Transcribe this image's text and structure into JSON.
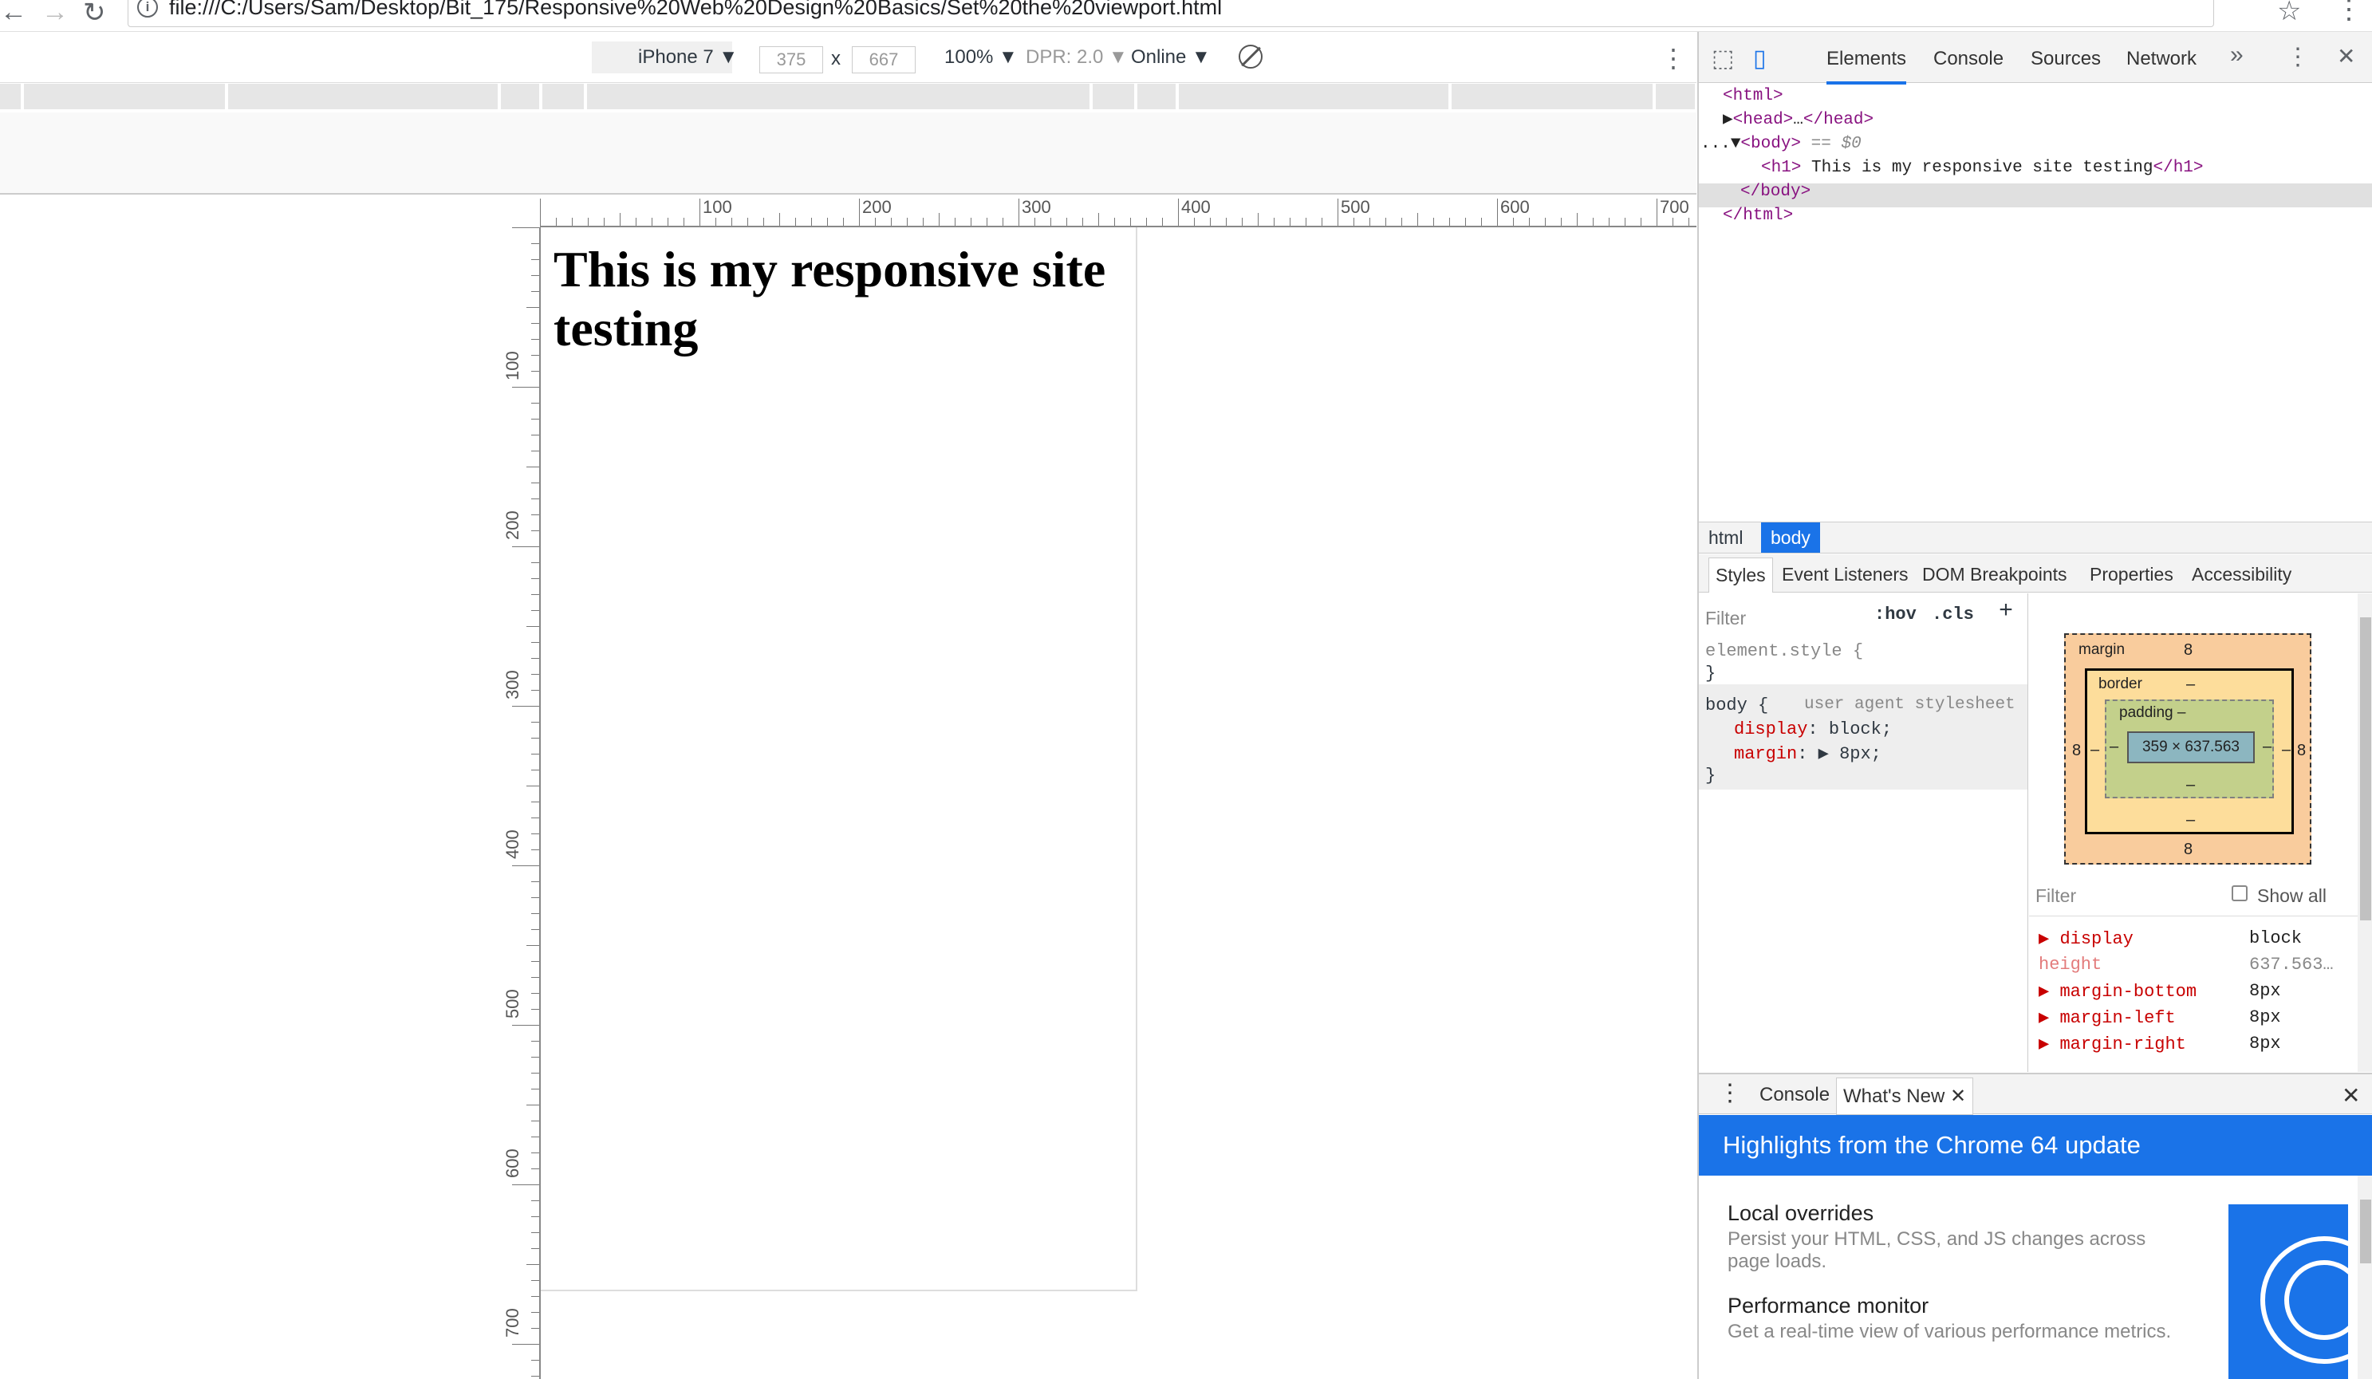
{
  "browser": {
    "back_icon": "arrow-left-icon",
    "forward_icon": "arrow-right-icon",
    "reload_icon": "reload-icon",
    "info_icon": "i",
    "url": "file:///C:/Users/Sam/Desktop/Bit_175/Responsive%20Web%20Design%20Basics/Set%20the%20viewport.html",
    "star": "☆",
    "menu": "⋮"
  },
  "device_toolbar": {
    "device": "iPhone 7",
    "width": "375",
    "times": "x",
    "height": "667",
    "zoom": "100%",
    "dpr": "DPR: 2.0",
    "network": "Online",
    "menu": "⋮"
  },
  "rulers": {
    "horizontal": [
      "100",
      "200",
      "300",
      "400",
      "500",
      "600",
      "700"
    ],
    "vertical": [
      "100",
      "200",
      "300",
      "400",
      "500",
      "600",
      "700"
    ]
  },
  "page": {
    "heading": "This is my responsive site testing"
  },
  "devtools": {
    "tabs": [
      "Elements",
      "Console",
      "Sources",
      "Network"
    ],
    "more": "»",
    "menu": "⋮",
    "close": "✕",
    "dom": {
      "html_open": "<html>",
      "head_open": "<head>",
      "head_ellipsis": "…",
      "head_close": "</head>",
      "dots": "...",
      "body_open": "<body>",
      "body_eq": "== $0",
      "h1_open": "<h1>",
      "h1_text": " This is my responsive site testing",
      "h1_close": "</h1>",
      "body_close": "</body>",
      "html_close": "</html>"
    },
    "breadcrumbs": [
      "html",
      "body"
    ],
    "subtabs": [
      "Styles",
      "Event Listeners",
      "DOM Breakpoints",
      "Properties",
      "Accessibility"
    ],
    "styles": {
      "filter": "Filter",
      "hov": ":hov",
      "cls": ".cls",
      "plus": "+",
      "element_style": "element.style {",
      "close_brace": "}",
      "body_selector": "body {",
      "ua_label": "user agent stylesheet",
      "display_prop": "display",
      "display_val": ": block;",
      "margin_prop": "margin",
      "margin_val": ": ▶ 8px;"
    },
    "box_model": {
      "margin_label": "margin",
      "margin_top": "8",
      "margin_bottom": "8",
      "margin_left": "8",
      "margin_right": "8",
      "border_label": "border",
      "border_top": "–",
      "border_bottom": "–",
      "border_left": "–",
      "border_right": "–",
      "padding_label": "padding –",
      "padding_bottom": "–",
      "padding_left": "–",
      "padding_right": "–",
      "content": "359 × 637.563"
    },
    "computed": {
      "filter": "Filter",
      "show_all": "Show all",
      "rows": [
        {
          "name": "display",
          "value": "block"
        },
        {
          "name": "height",
          "value": "637.563…"
        },
        {
          "name": "margin-bottom",
          "value": "8px"
        },
        {
          "name": "margin-left",
          "value": "8px"
        },
        {
          "name": "margin-right",
          "value": "8px"
        }
      ]
    },
    "drawer": {
      "menu": "⋮",
      "tabs": [
        "Console",
        "What's New"
      ],
      "tab_close": "✕",
      "close": "✕",
      "banner": "Highlights from the Chrome 64 update",
      "items": [
        {
          "title": "Local overrides",
          "desc": "Persist your HTML, CSS, and JS changes across page loads."
        },
        {
          "title": "Performance monitor",
          "desc": "Get a real-time view of various performance metrics."
        }
      ]
    }
  }
}
